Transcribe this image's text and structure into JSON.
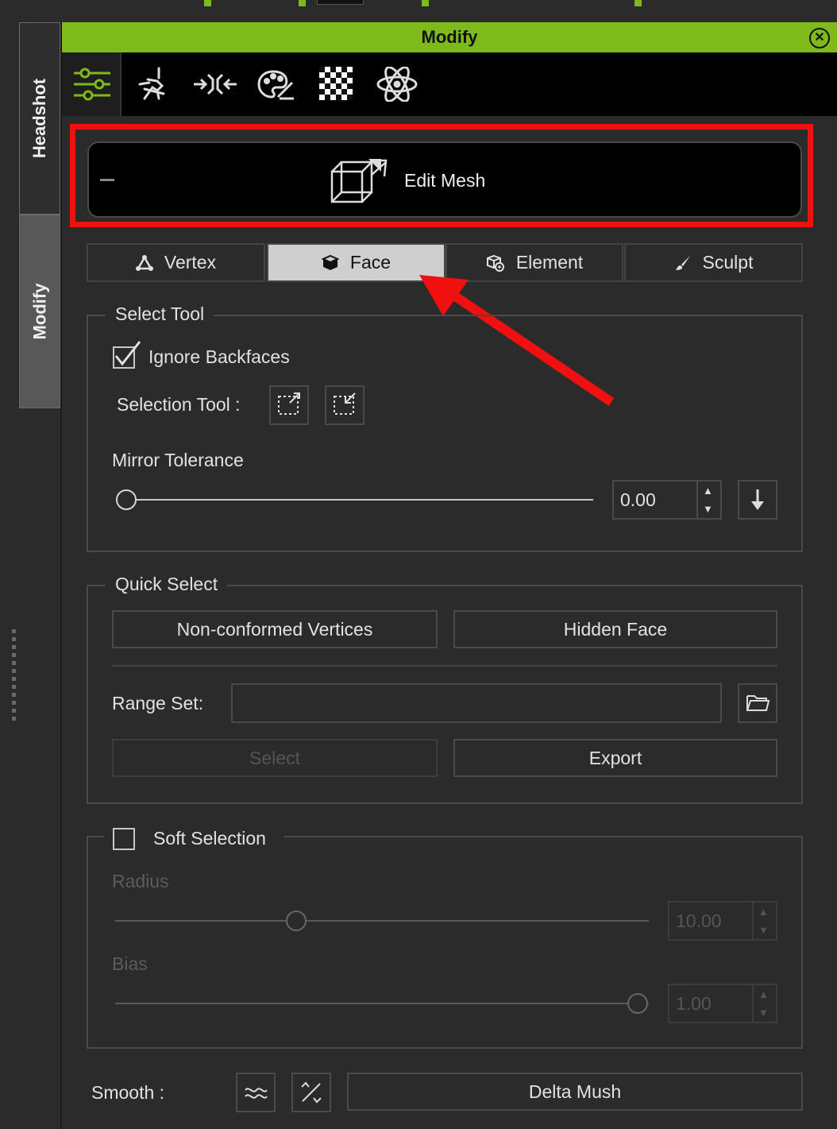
{
  "colors": {
    "accent": "#7fba1b",
    "highlight": "#f01010",
    "panel": "#2b2b2b"
  },
  "sidebar": {
    "tabs": [
      {
        "label": "Headshot"
      },
      {
        "label": "Modify"
      }
    ]
  },
  "titlebar": {
    "title": "Modify",
    "close_icon": "close-circle-icon"
  },
  "toolbar": {
    "icons": [
      "sliders-icon",
      "morph-pose-icon",
      "scale-arrows-icon",
      "palette-icon",
      "checker-texture-icon",
      "atom-physics-icon"
    ]
  },
  "edit_mesh": {
    "label": "Edit Mesh",
    "collapse_symbol": "–"
  },
  "mode_tabs": [
    {
      "label": "Vertex",
      "icon": "vertex-icon",
      "active": false
    },
    {
      "label": "Face",
      "icon": "cube-face-icon",
      "active": true
    },
    {
      "label": "Element",
      "icon": "element-icon",
      "active": false
    },
    {
      "label": "Sculpt",
      "icon": "brush-icon",
      "active": false
    }
  ],
  "select_tool": {
    "title": "Select Tool",
    "ignore_backfaces": {
      "label": "Ignore Backfaces",
      "checked": true
    },
    "selection_tool_label": "Selection Tool :",
    "mirror_tolerance": {
      "label": "Mirror Tolerance",
      "value": "0.00",
      "slider_fraction": 0
    }
  },
  "quick_select": {
    "title": "Quick Select",
    "non_conformed": "Non-conformed Vertices",
    "hidden_face": "Hidden Face",
    "range_set_label": "Range Set:",
    "range_set_value": "",
    "select": "Select",
    "export": "Export"
  },
  "soft_selection": {
    "title": "Soft Selection",
    "checked": false,
    "radius": {
      "label": "Radius",
      "value": "10.00"
    },
    "bias": {
      "label": "Bias",
      "value": "1.00"
    }
  },
  "smooth": {
    "label": "Smooth :",
    "delta_mush": "Delta Mush"
  }
}
